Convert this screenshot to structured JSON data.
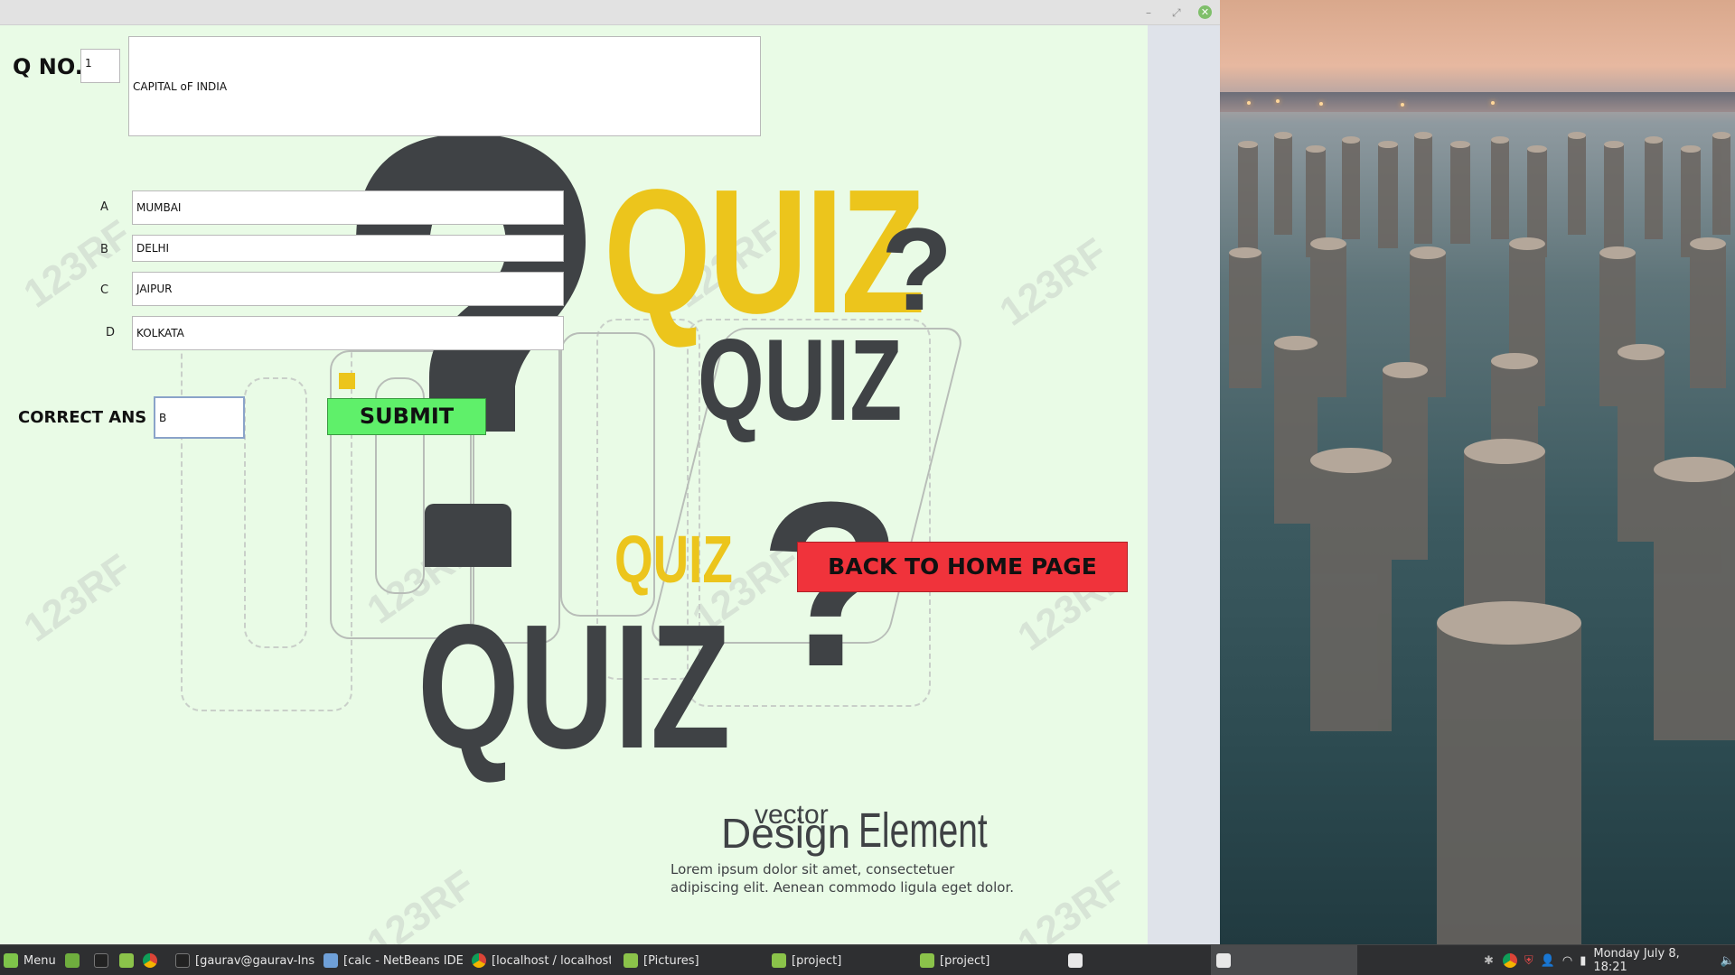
{
  "window": {
    "title_buttons": {
      "minimize": "–",
      "maximize": "⤢",
      "close": "✕"
    }
  },
  "form": {
    "qno_label": "Q NO.",
    "qno_value": "1",
    "question_text": "CAPITAL oF INDIA",
    "options": [
      {
        "label": "A",
        "value": "MUMBAI"
      },
      {
        "label": "B",
        "value": "DELHI"
      },
      {
        "label": "C",
        "value": "JAIPUR"
      },
      {
        "label": "D",
        "value": "KOLKATA"
      }
    ],
    "correct_label": "CORRECT ANS",
    "correct_value": "B",
    "submit_label": "SUBMIT",
    "back_label": "BACK TO HOME PAGE"
  },
  "poster": {
    "quiz_words": [
      "QUIZ",
      "QUIZ",
      "QUIZ",
      "QUIZ"
    ],
    "question_marks": [
      "?",
      "?"
    ],
    "vector": "vector",
    "design": "Design",
    "element": "Element",
    "lorem_1": "Lorem ipsum dolor sit amet, consectetuer",
    "lorem_2": "adipiscing elit. Aenean commodo ligula eget dolor.",
    "watermark": "123RF",
    "colors": {
      "yellow": "#ecc51c",
      "dark": "#3f4245"
    }
  },
  "taskbar": {
    "menu_label": "Menu",
    "windows": [
      {
        "label": "[gaurav@gaurav-Ins...",
        "icon": "terminal-icon"
      },
      {
        "label": "[calc - NetBeans IDE ...",
        "icon": "netbeans-icon"
      },
      {
        "label": "[localhost / localhost ...",
        "icon": "chrome-icon"
      },
      {
        "label": "[Pictures]",
        "icon": "folder-icon"
      },
      {
        "label": "[project]",
        "icon": "folder-icon"
      },
      {
        "label": "[project]",
        "icon": "folder-icon"
      }
    ],
    "clock": "Monday July  8, 18:21"
  }
}
